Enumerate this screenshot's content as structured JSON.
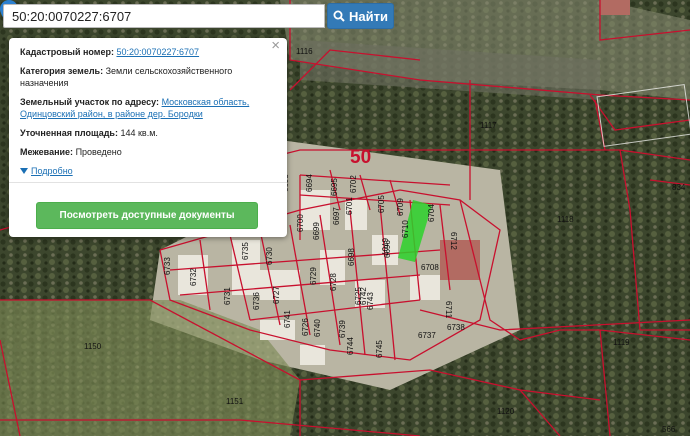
{
  "search": {
    "value": "50:20:0070227:6707",
    "button_label": "Найти"
  },
  "popup": {
    "cadastral_label": "Кадастровый номер:",
    "cadastral_value": "50:20:0070227:6707",
    "category_label": "Категория земель:",
    "category_value": "Земли сельскохозяйственного назначения",
    "address_label": "Земельный участок по адресу:",
    "address_value": "Московская область, Одинцовский район, в районе дер. Бородки",
    "area_label": "Уточненная площадь:",
    "area_value": "144 кв.м.",
    "survey_label": "Межевание:",
    "survey_value": "Проведено",
    "details_link": "Подробно",
    "close_symbol": "×",
    "docs_button": "Посмотреть доступные документы"
  },
  "map": {
    "region_label": "50",
    "parcel_labels": [
      "1116",
      "1117",
      "1118",
      "834",
      "1119",
      "1150",
      "1151",
      "1120",
      "566",
      "6708",
      "6737",
      "6738",
      "6711",
      "6712",
      "6704",
      "6709",
      "6710",
      "6705",
      "6707",
      "6701",
      "6702",
      "6695",
      "6694",
      "6693",
      "6699",
      "6700",
      "6697",
      "6698",
      "6696",
      "6733",
      "6732",
      "6735",
      "6736",
      "6731",
      "6730",
      "6729",
      "6728",
      "6727",
      "6726",
      "6725",
      "6741",
      "6740",
      "6739",
      "6743",
      "6742",
      "6744",
      "6745"
    ]
  }
}
